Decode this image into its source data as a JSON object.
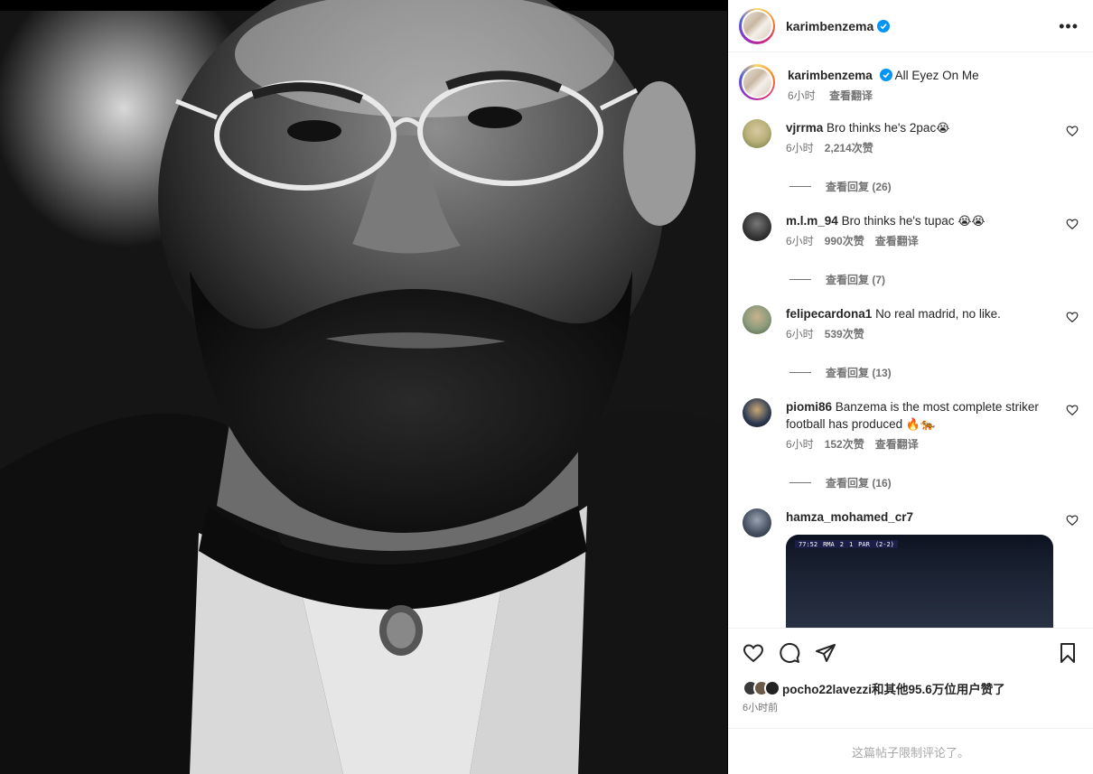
{
  "post": {
    "username": "karimbenzema",
    "more_label": "•••"
  },
  "caption": {
    "username": "karimbenzema",
    "text": "All Eyez On Me",
    "time": "6小时",
    "translate": "查看翻译"
  },
  "comments": [
    {
      "username": "vjrrma",
      "text": "Bro thinks he's 2pac",
      "emoji": "😭",
      "time": "6小时",
      "likes": "2,214次赞",
      "translate": "",
      "replies": "查看回复 (26)",
      "avatar_color": "#b9b07a"
    },
    {
      "username": "m.l.m_94",
      "text": "Bro thinks he's tupac",
      "emoji": "😭😭",
      "time": "6小时",
      "likes": "990次赞",
      "translate": "查看翻译",
      "replies": "查看回复 (7)",
      "avatar_color": "#3a3a3a"
    },
    {
      "username": "felipecardona1",
      "text": "No real madrid, no like.",
      "emoji": "",
      "time": "6小时",
      "likes": "539次赞",
      "translate": "",
      "replies": "查看回复 (13)",
      "avatar_color": "#8a9a7a"
    },
    {
      "username": "piomi86",
      "text": "Banzema is the most complete striker football has produced",
      "emoji": "🔥🐅",
      "time": "6小时",
      "likes": "152次赞",
      "translate": "查看翻译",
      "replies": "查看回复 (16)",
      "avatar_color": "#2d3a52"
    },
    {
      "username": "hamza_mohamed_cr7",
      "text": "",
      "emoji": "",
      "time": "",
      "likes": "",
      "translate": "",
      "replies": "",
      "avatar_color": "#4a5566"
    }
  ],
  "video_score": {
    "clock": "77:52",
    "home": "RMA",
    "home_score": "2",
    "away_score": "1",
    "away": "PAR",
    "agg": "(2-2)"
  },
  "likes_summary": {
    "text": "pocho22lavezzi和其他95.6万位用户赞了",
    "posted": "6小时前"
  },
  "footer": {
    "text": "这篇帖子限制评论了。"
  }
}
